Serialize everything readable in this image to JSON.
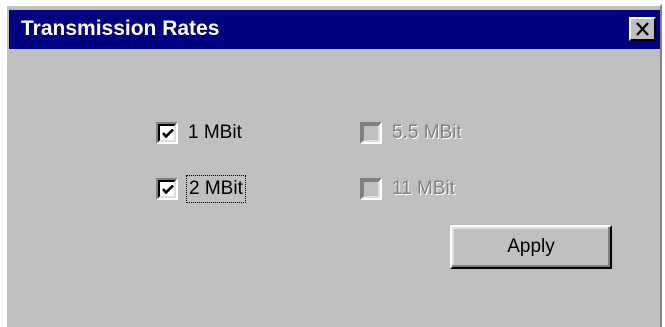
{
  "dialog": {
    "title": "Transmission Rates",
    "close_icon": "close-icon"
  },
  "rates": [
    {
      "label": "1 MBit",
      "checked": true,
      "enabled": true
    },
    {
      "label": "2 MBit",
      "checked": true,
      "enabled": true
    },
    {
      "label": "5.5 MBit",
      "checked": false,
      "enabled": false
    },
    {
      "label": "11 MBit",
      "checked": false,
      "enabled": false
    }
  ],
  "actions": {
    "apply_label": "Apply"
  },
  "colors": {
    "titlebar": "#000080",
    "face": "#c0c0c0",
    "disabled_text": "#808080"
  }
}
